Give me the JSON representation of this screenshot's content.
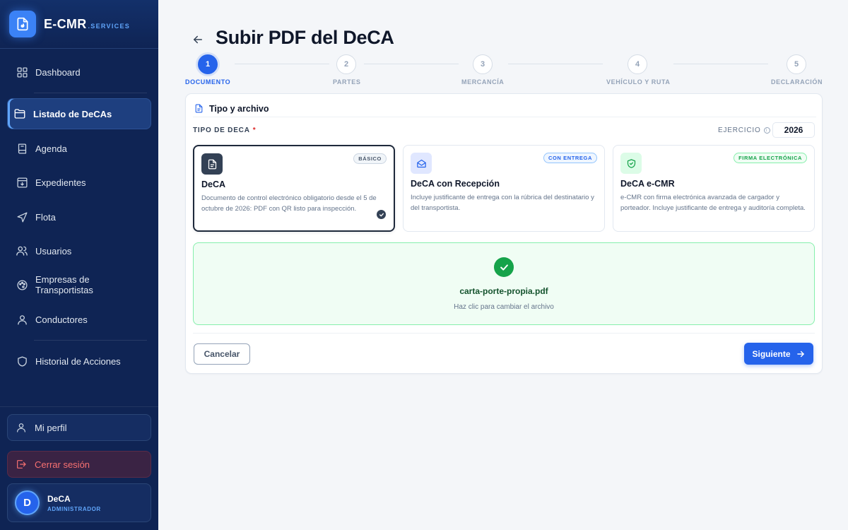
{
  "brand": {
    "name": "E-CMR",
    "suffix": ".SERVICES",
    "icon": "document-fire-icon"
  },
  "sidebar": {
    "items": [
      {
        "label": "Dashboard",
        "icon": "grid-icon",
        "active": false
      },
      {
        "label": "Listado de DeCAs",
        "icon": "folder-icon",
        "active": true
      },
      {
        "label": "Agenda",
        "icon": "book-icon",
        "active": false
      },
      {
        "label": "Expedientes",
        "icon": "archive-icon",
        "active": false
      },
      {
        "label": "Flota",
        "icon": "navigation-icon",
        "active": false
      },
      {
        "label": "Usuarios",
        "icon": "users-icon",
        "active": false
      },
      {
        "label": "Empresas de Transportistas",
        "icon": "palette-icon",
        "active": false
      },
      {
        "label": "Conductores",
        "icon": "user-icon",
        "active": false
      },
      {
        "label": "Historial de Acciones",
        "icon": "shield-icon",
        "active": false
      }
    ],
    "profile_label": "Mi perfil",
    "logout_label": "Cerrar sesión",
    "user": {
      "initial": "D",
      "name": "DeCA",
      "role": "ADMINISTRADOR"
    }
  },
  "page": {
    "title": "Subir PDF del DeCA"
  },
  "stepper": {
    "steps": [
      {
        "number": "1",
        "label": "DOCUMENTO",
        "active": true
      },
      {
        "number": "2",
        "label": "PARTES",
        "active": false
      },
      {
        "number": "3",
        "label": "MERCANCÍA",
        "active": false
      },
      {
        "number": "4",
        "label": "VEHÍCULO Y RUTA",
        "active": false
      },
      {
        "number": "5",
        "label": "DECLARACIÓN",
        "active": false
      }
    ]
  },
  "card": {
    "header_title": "Tipo y archivo",
    "type_label": "TIPO DE DECA",
    "required_mark": "*",
    "ejercicio_label": "EJERCICIO",
    "ejercicio_value": "2026",
    "types": [
      {
        "title": "DeCA",
        "badge": "BÁSICO",
        "description": "Documento de control electrónico obligatorio desde el 5 de octubre de 2026: PDF con QR listo para inspección.",
        "selected": true,
        "icon": "file-text-icon"
      },
      {
        "title": "DeCA con Recepción",
        "badge": "CON ENTREGA",
        "description": "Incluye justificante de entrega con la rúbrica del destinatario y del transportista.",
        "selected": false,
        "icon": "mail-open-icon"
      },
      {
        "title": "DeCA e-CMR",
        "badge": "FIRMA ELECTRÓNICA",
        "description": "e-CMR con firma electrónica avanzada de cargador y porteador. Incluye justificante de entrega y auditoría completa.",
        "selected": false,
        "icon": "shield-check-icon"
      }
    ],
    "file_name": "carta-porte-propia.pdf",
    "file_hint": "Haz clic para cambiar el archivo",
    "cancel_label": "Cancelar",
    "next_label": "Siguiente"
  },
  "colors": {
    "sidebar_bg": "#0f2454",
    "accent": "#2563eb",
    "success": "#16a34a"
  }
}
